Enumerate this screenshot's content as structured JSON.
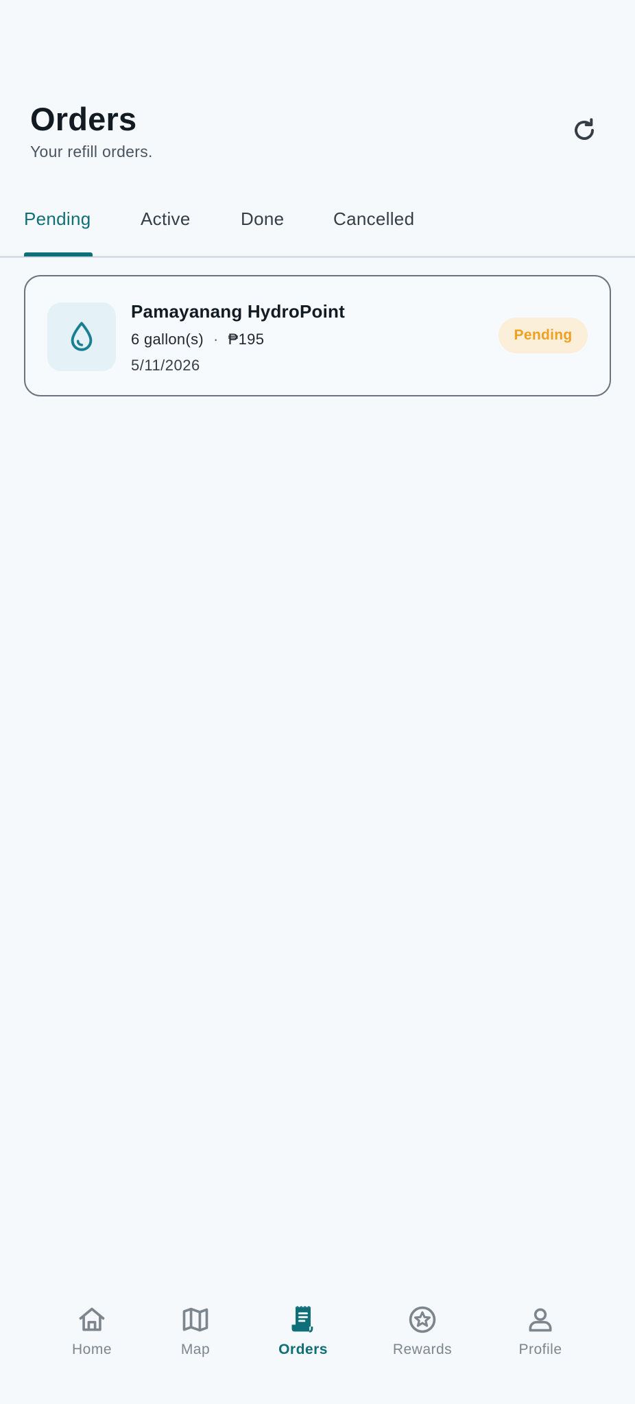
{
  "header": {
    "title": "Orders",
    "subtitle": "Your refill orders."
  },
  "tabs": [
    {
      "label": "Pending",
      "active": true
    },
    {
      "label": "Active",
      "active": false
    },
    {
      "label": "Done",
      "active": false
    },
    {
      "label": "Cancelled",
      "active": false
    }
  ],
  "orders": [
    {
      "station": "Pamayanang HydroPoint",
      "quantity": "6 gallon(s)",
      "separator": "·",
      "price": "₱195",
      "date": "5/11/2026",
      "status": "Pending",
      "icon": "water-drop-icon"
    }
  ],
  "nav": {
    "home": "Home",
    "map": "Map",
    "orders": "Orders",
    "rewards": "Rewards",
    "profile": "Profile",
    "active": "orders"
  },
  "colors": {
    "accent": "#0e6f78",
    "background": "#f5f9fc",
    "pending_text": "#f0a020",
    "pending_bg": "#fbefd9",
    "inactive_nav": "#7d858d"
  }
}
